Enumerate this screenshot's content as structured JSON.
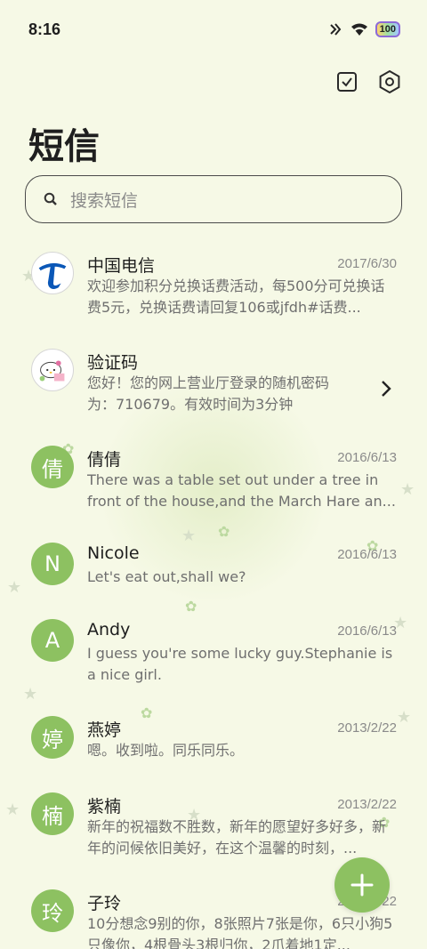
{
  "status_bar": {
    "time": "8:16",
    "battery": "100"
  },
  "header": {
    "title": "短信"
  },
  "search": {
    "placeholder": "搜索短信"
  },
  "conversations": [
    {
      "name": "中国电信",
      "date": "2017/6/30",
      "avatar": "china-telecom-logo",
      "preview": "欢迎参加积分兑换话费活动，每500分可兑换话费5元，兑换话费请回复106或jfdh#话费..."
    },
    {
      "name": "验证码",
      "date": "",
      "avatar": "hello-kitty-image",
      "preview": "您好！您的网上营业厅登录的随机密码为：710679。有效时间为3分钟"
    },
    {
      "name": "倩倩",
      "date": "2016/6/13",
      "avatar_text": "倩",
      "preview": "There was a table set out under a tree in front of the house,and the March Hare an..."
    },
    {
      "name": "Nicole",
      "date": "2016/6/13",
      "avatar_text": "N",
      "preview": "Let's eat out,shall we?"
    },
    {
      "name": "Andy",
      "date": "2016/6/13",
      "avatar_text": "A",
      "preview": "I guess you're some lucky guy.Stephanie is a nice girl."
    },
    {
      "name": "燕婷",
      "date": "2013/2/22",
      "avatar_text": "婷",
      "preview": "嗯。收到啦。同乐同乐。"
    },
    {
      "name": "紫楠",
      "date": "2013/2/22",
      "avatar_text": "楠",
      "preview": "新年的祝福数不胜数，新年的愿望好多好多，新年的问候依旧美好，在这个温馨的时刻，..."
    },
    {
      "name": "子玲",
      "date": "2013/2/22",
      "avatar_text": "玲",
      "preview": "10分想念9别的你，8张照片7张是你，6只小狗5只像你，4根骨头3根归你，2爪着地1定..."
    }
  ],
  "colors": {
    "accent": "#8dc161",
    "background": "#f6f9e6"
  },
  "icons": [
    "checklist-icon",
    "settings-icon",
    "search-icon",
    "chevron-right-icon",
    "plus-icon"
  ]
}
